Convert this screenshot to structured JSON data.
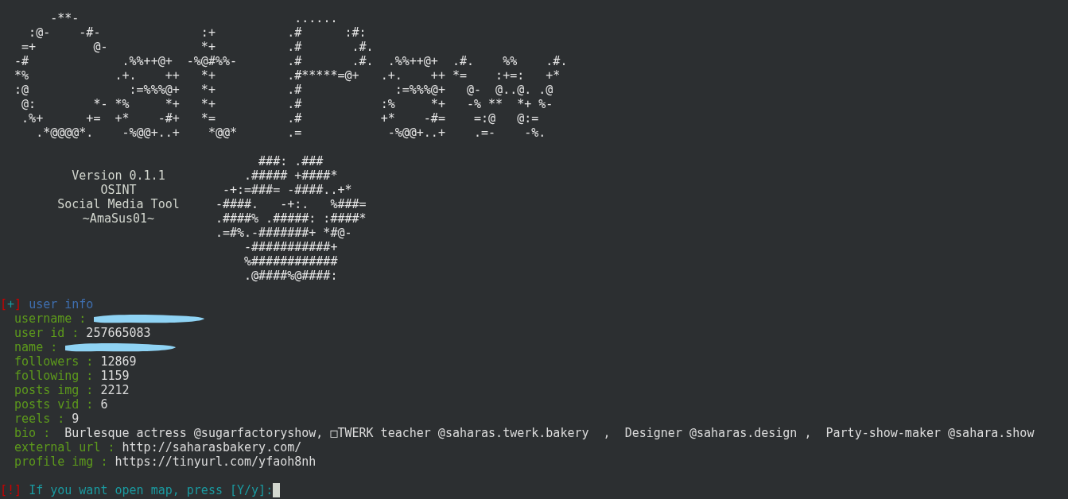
{
  "logo_lines": [
    "       -**-                              ......",
    "    :@-    -#-              :+          .#      :#:",
    "   =+        @-             *+          .#       .#.",
    "  -#             .%%++@+  -%@#%%-       .#       .#.  .%%++@+  .#.    %%    .#.",
    "  *%            .+.    ++   *+          .#*****=@+   .+.    ++ *=    :+=:   +*",
    "  :@              :=%%%@+   *+          .#             :=%%%@+   @-  @..@. .@",
    "   @:        *- *%     *+   *+          .#           :%     *+   -% **  *+ %-",
    "   .%+      +=  +*    -#+   *=          .#           +*    -#=    =:@   @:=",
    "     .*@@@@*.    -%@@+..+    *@@*       .=            -%@@+..+    .=-    -%."
  ],
  "banner": {
    "info_lines": [
      "Version 0.1.1",
      "OSINT",
      "Social Media Tool",
      "~AmaSus01~"
    ],
    "art_lines": [
      "      ###: .###",
      "    .##### +####*",
      " -+:=###= -####..+*",
      "-####.   -+:.   %###=",
      ".####% .#####: :####*",
      ".=#%.-#######+ *#@-",
      "    -###########+",
      "    %############",
      "    .@####%@####:"
    ]
  },
  "user_info": {
    "marker": [
      "[",
      "+",
      "]"
    ],
    "title": "user info",
    "fields": [
      {
        "label": "username :",
        "redacted": true
      },
      {
        "label": "user id :",
        "value": "257665083",
        "redacted": false
      },
      {
        "label": "name :",
        "redacted": true
      },
      {
        "label": "followers :",
        "value": "12869",
        "redacted": false
      },
      {
        "label": "following :",
        "value": "1159",
        "redacted": false
      },
      {
        "label": "posts img :",
        "value": "2212",
        "redacted": false
      },
      {
        "label": "posts vid :",
        "value": "6",
        "redacted": false
      },
      {
        "label": "reels :",
        "value": "9",
        "redacted": false
      },
      {
        "label": "bio :",
        "value": " Burlesque actress @sugarfactoryshow, □TWERK teacher @saharas.twerk.bakery  ,  Designer @saharas.design ,  Party-show-maker @sahara.show",
        "redacted": false
      },
      {
        "label": "external url :",
        "value": "http://saharasbakery.com/",
        "redacted": false
      },
      {
        "label": "profile img :",
        "value": "https://tinyurl.com/yfaoh8nh",
        "redacted": false
      }
    ]
  },
  "prompt": {
    "marker": [
      "[",
      "!",
      "]"
    ],
    "text": "If you want open map, press [Y/y]:"
  }
}
